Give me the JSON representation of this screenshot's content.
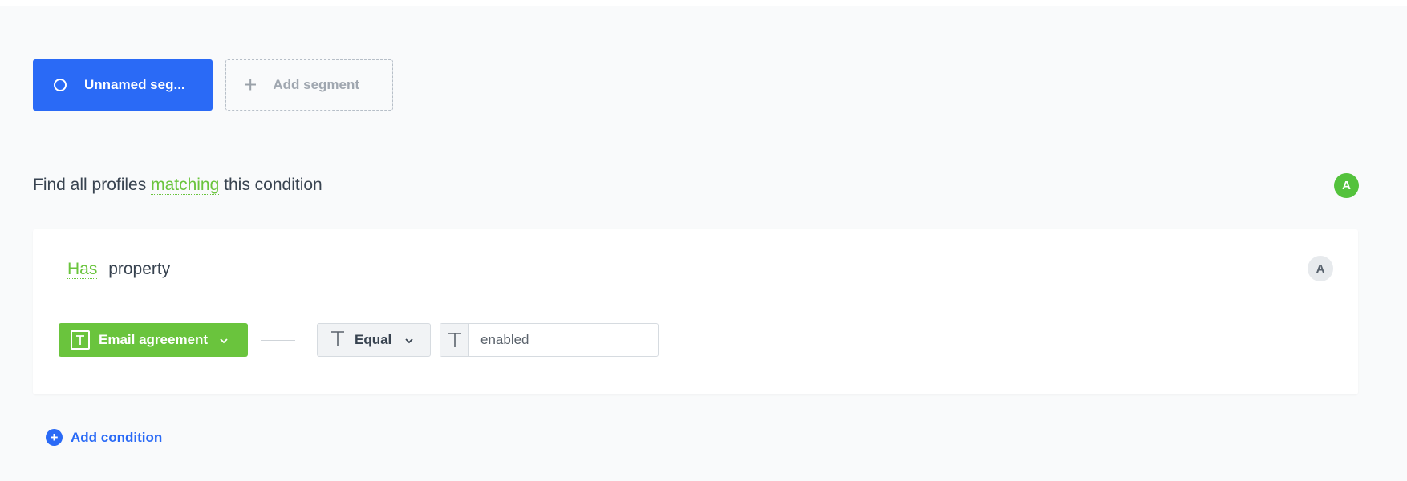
{
  "segments": {
    "active_label": "Unnamed seg...",
    "add_label": "Add segment"
  },
  "heading": {
    "prefix": "Find all profiles",
    "keyword": "matching",
    "suffix": "this condition",
    "avatar": "A"
  },
  "condition": {
    "keyword": "Has",
    "rest": "property",
    "avatar": "A",
    "attribute_label": "Email agreement",
    "operator_label": "Equal",
    "value": "enabled"
  },
  "add_condition_label": "Add condition",
  "colors": {
    "primary": "#2a6af6",
    "green": "#6ac43d",
    "avatar_green": "#54c23c",
    "background": "#f9fafb",
    "text": "#384350"
  },
  "icons": [
    "circle-icon",
    "plus-icon",
    "text-type-icon",
    "chevron-down-icon",
    "add-circle-icon"
  ]
}
